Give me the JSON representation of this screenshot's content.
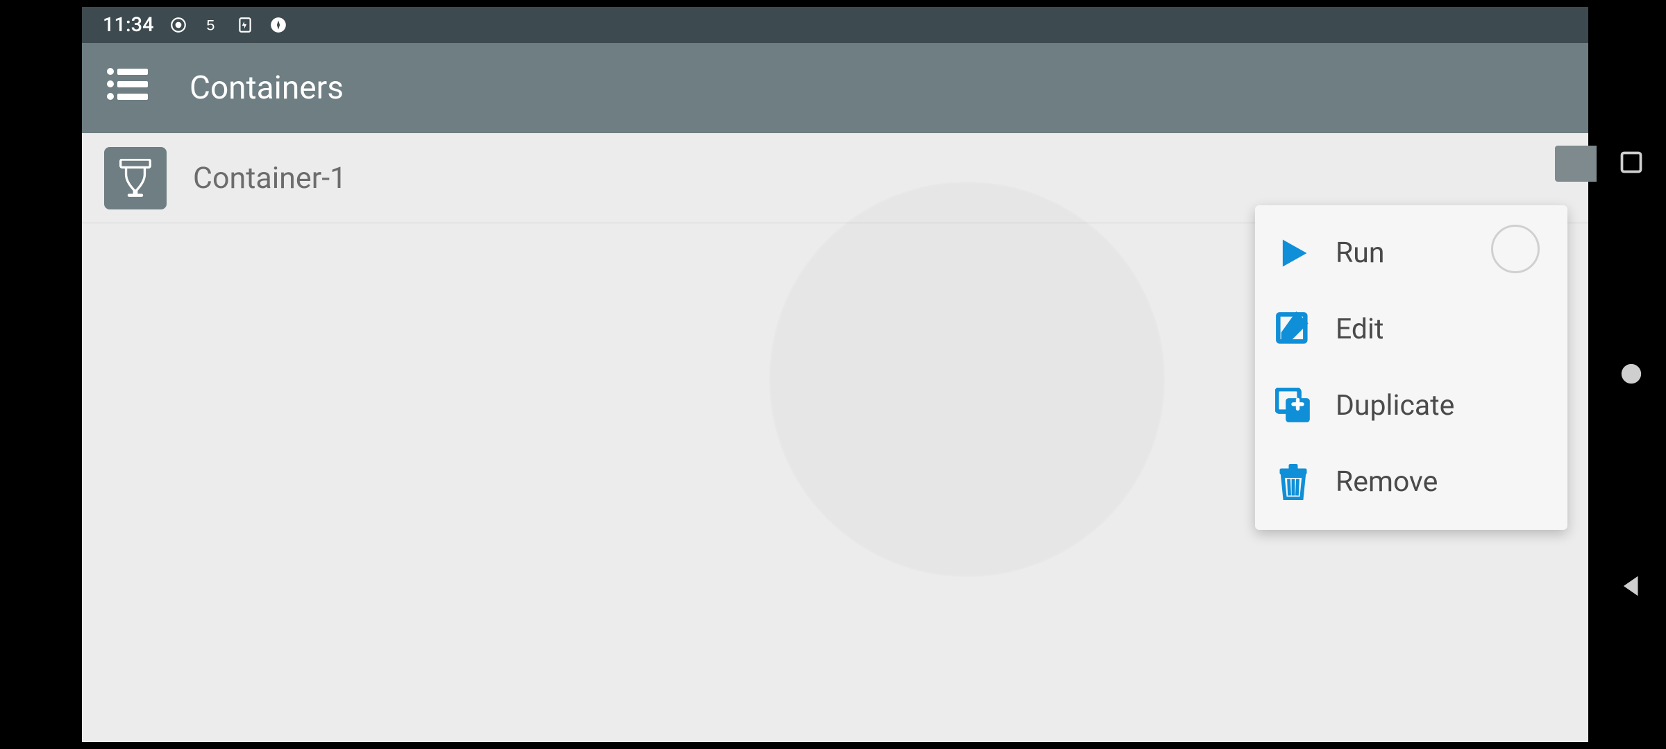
{
  "status_bar": {
    "time": "11:34"
  },
  "app_bar": {
    "title": "Containers"
  },
  "list": {
    "items": [
      {
        "label": "Container-1"
      }
    ]
  },
  "context_menu": {
    "items": [
      {
        "label": "Run"
      },
      {
        "label": "Edit"
      },
      {
        "label": "Duplicate"
      },
      {
        "label": "Remove"
      }
    ]
  },
  "colors": {
    "accent": "#0f8fd7",
    "app_bar": "#6e7e82",
    "status_bar": "#3d4a4f",
    "surface": "#ececec"
  }
}
